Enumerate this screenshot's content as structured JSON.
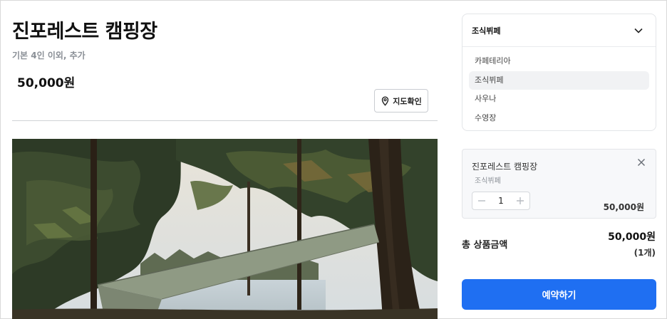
{
  "product": {
    "title": "진포레스트 캠핑장",
    "subtitle": "기본 4인 이외, 추가",
    "price": "50,000원",
    "map_button_label": "지도확인"
  },
  "option_dropdown": {
    "selected": "조식뷔페",
    "options": [
      "카페테리아",
      "조식뷔페",
      "사우나",
      "수영장"
    ],
    "highlighted_index": 1
  },
  "cart_item": {
    "name": "진포레스트 캠핑장",
    "option": "조식뷔페",
    "quantity": "1",
    "price": "50,000원"
  },
  "total": {
    "label": "총 상품금액",
    "amount": "50,000원",
    "count": "(1개)"
  },
  "reserve_button_label": "예약하기",
  "colors": {
    "primary": "#1f6ff2",
    "muted_text": "#8a8f96",
    "border": "#e3e5e8"
  }
}
